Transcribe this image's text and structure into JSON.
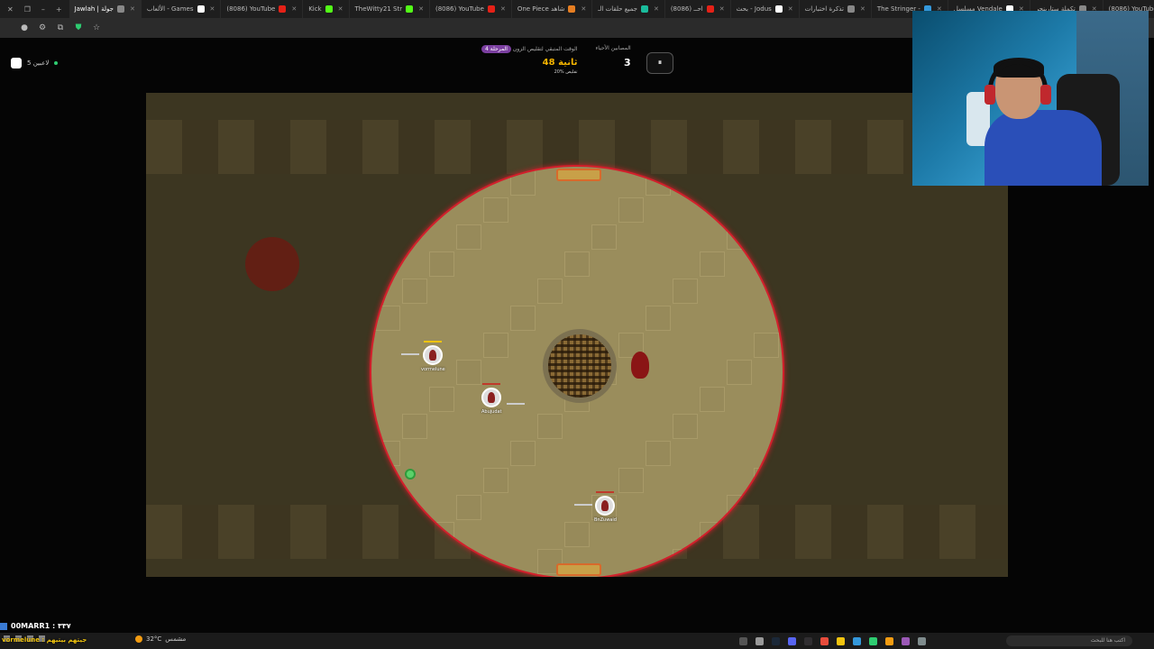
{
  "browser": {
    "tabs": [
      {
        "label": "Jawlah | جولة",
        "active": true,
        "color": "#888888"
      },
      {
        "label": "الألعاب - Games",
        "active": false,
        "color": "#ffffff"
      },
      {
        "label": "(8086) YouTube",
        "active": false,
        "color": "#e62117"
      },
      {
        "label": "Kick",
        "active": false,
        "color": "#53fc18"
      },
      {
        "label": "TheWitty21 Str",
        "active": false,
        "color": "#53fc18"
      },
      {
        "label": "(8086) YouTube",
        "active": false,
        "color": "#e62117"
      },
      {
        "label": "One Piece شاهد",
        "active": false,
        "color": "#e67e22"
      },
      {
        "label": "جميع حلقات الـ",
        "active": false,
        "color": "#1abc9c"
      },
      {
        "label": "(8086) احــ",
        "active": false,
        "color": "#e62117"
      },
      {
        "label": "بحث - Jodus",
        "active": false,
        "color": "#ffffff"
      },
      {
        "label": "تذكرة اختبارات",
        "active": false,
        "color": "#888888"
      },
      {
        "label": "The Stringer -",
        "active": false,
        "color": "#3498db"
      },
      {
        "label": "مسلسل Vendale",
        "active": false,
        "color": "#ffffff"
      },
      {
        "label": "تكملة ستارينجر",
        "active": false,
        "color": "#888888"
      },
      {
        "label": "(8086) YouTube",
        "active": false,
        "color": "#e62117"
      }
    ]
  },
  "game": {
    "online_players": "5 لاعبين",
    "timer_label": "الوقت المتبقي لتقليص الزون",
    "stage_badge": "المرحلة 4",
    "timer_value": "48 ثانية",
    "shrink_pct": "20% تقليص",
    "alive_label": "المصابين الأحياء",
    "alive_count": "3",
    "pause_icon": "⏸",
    "players": [
      {
        "name": "vormelune"
      },
      {
        "name": "Abujudat"
      },
      {
        "name": "BnZuwaid"
      }
    ]
  },
  "stream": {
    "viewer_line": "00MARR1 : ٣٣٧",
    "subtitle": "vormelune : جيتهم بيتيهم"
  },
  "taskbar": {
    "temp": "32°C",
    "weather": "مشمس",
    "search_placeholder": "اكتب هنا للبحث"
  }
}
